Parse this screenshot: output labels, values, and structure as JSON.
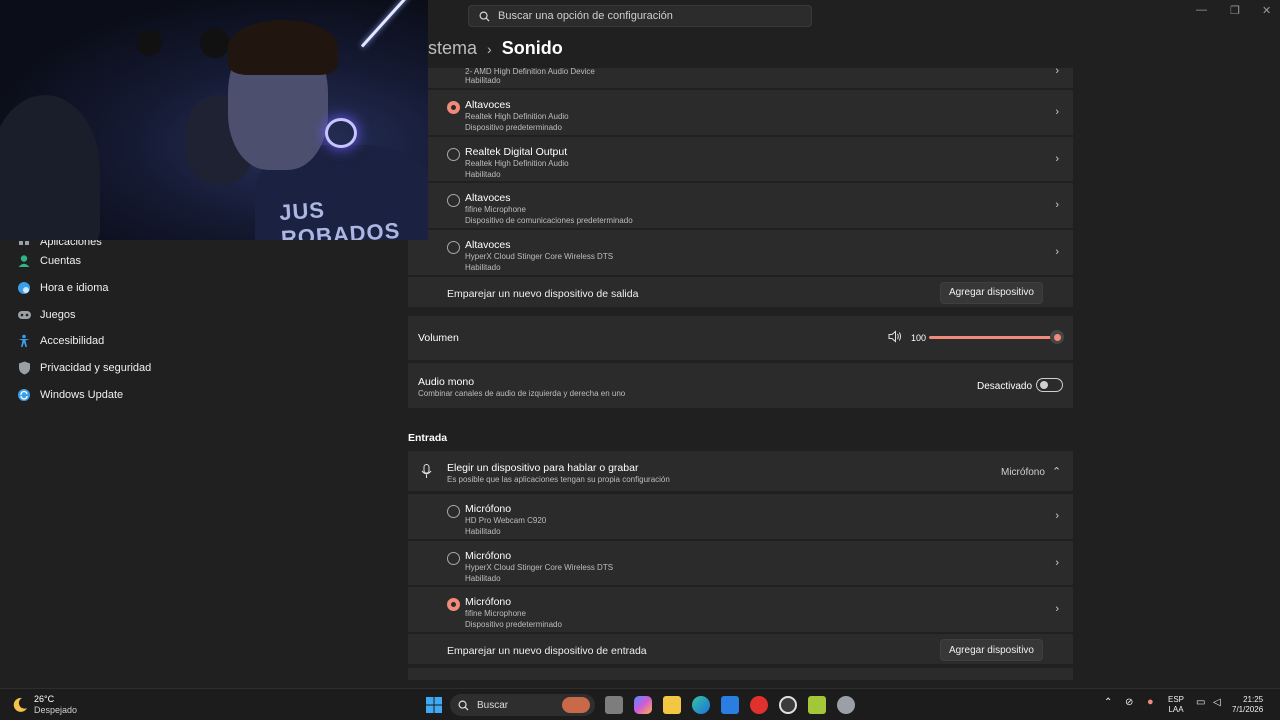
{
  "search": {
    "placeholder": "Buscar una opción de configuración"
  },
  "breadcrumb": {
    "parent": "stema",
    "separator": "›",
    "current": "Sonido"
  },
  "webcam": {
    "shirt_text": "JUS ROBADOS"
  },
  "sidebar": {
    "items": [
      {
        "label": "Aplicaciones",
        "icon": "apps-icon",
        "color": "#9aa0a6"
      },
      {
        "label": "Cuentas",
        "icon": "accounts-icon",
        "color": "#2fb38a"
      },
      {
        "label": "Hora e idioma",
        "icon": "time-language-icon",
        "color": "#3b9ee8"
      },
      {
        "label": "Juegos",
        "icon": "gamepad-icon",
        "color": "#9aa0a6"
      },
      {
        "label": "Accesibilidad",
        "icon": "accessibility-icon",
        "color": "#3b9ee8"
      },
      {
        "label": "Privacidad y seguridad",
        "icon": "shield-icon",
        "color": "#9aa0a6"
      },
      {
        "label": "Windows Update",
        "icon": "windows-update-icon",
        "color": "#3b9ee8"
      }
    ]
  },
  "output": {
    "partial_top": {
      "line1": "2- AMD High Definition Audio Device",
      "line2": "Habilitado"
    },
    "devices": [
      {
        "name": "Altavoces",
        "detail": "Realtek High Definition Audio",
        "status": "Dispositivo predeterminado",
        "selected": true
      },
      {
        "name": "Realtek Digital Output",
        "detail": "Realtek High Definition Audio",
        "status": "Habilitado",
        "selected": false
      },
      {
        "name": "Altavoces",
        "detail": "fifine Microphone",
        "status": "Dispositivo de comunicaciones predeterminado",
        "selected": false
      },
      {
        "name": "Altavoces",
        "detail": "HyperX Cloud Stinger Core Wireless DTS",
        "status": "Habilitado",
        "selected": false
      }
    ],
    "pair_label": "Emparejar un nuevo dispositivo de salida",
    "add_button": "Agregar dispositivo"
  },
  "volume": {
    "label": "Volumen",
    "value": "100",
    "level": 1.0
  },
  "mono": {
    "label": "Audio mono",
    "description": "Combinar canales de audio de izquierda y derecha en uno",
    "state": "Desactivado"
  },
  "input": {
    "section_title": "Entrada",
    "choose_label": "Elegir un dispositivo para hablar o grabar",
    "choose_sub": "Es posible que las aplicaciones tengan su propia configuración",
    "current": "Micrófono",
    "devices": [
      {
        "name": "Micrófono",
        "detail": "HD Pro Webcam C920",
        "status": "Habilitado",
        "selected": false
      },
      {
        "name": "Micrófono",
        "detail": "HyperX Cloud Stinger Core Wireless DTS",
        "status": "Habilitado",
        "selected": false
      },
      {
        "name": "Micrófono",
        "detail": "fifine Microphone",
        "status": "Dispositivo predeterminado",
        "selected": true
      }
    ],
    "pair_label": "Emparejar un nuevo dispositivo de entrada",
    "add_button": "Agregar dispositivo"
  },
  "taskbar": {
    "weather_temp": "26°C",
    "weather_desc": "Despejado",
    "search_label": "Buscar",
    "lang_line1": "ESP",
    "lang_line2": "LAA",
    "time": "21:25",
    "date": "7/1/2026"
  },
  "colors": {
    "accent": "#f08a7a",
    "background": "#202020",
    "card": "#2b2b2b"
  }
}
